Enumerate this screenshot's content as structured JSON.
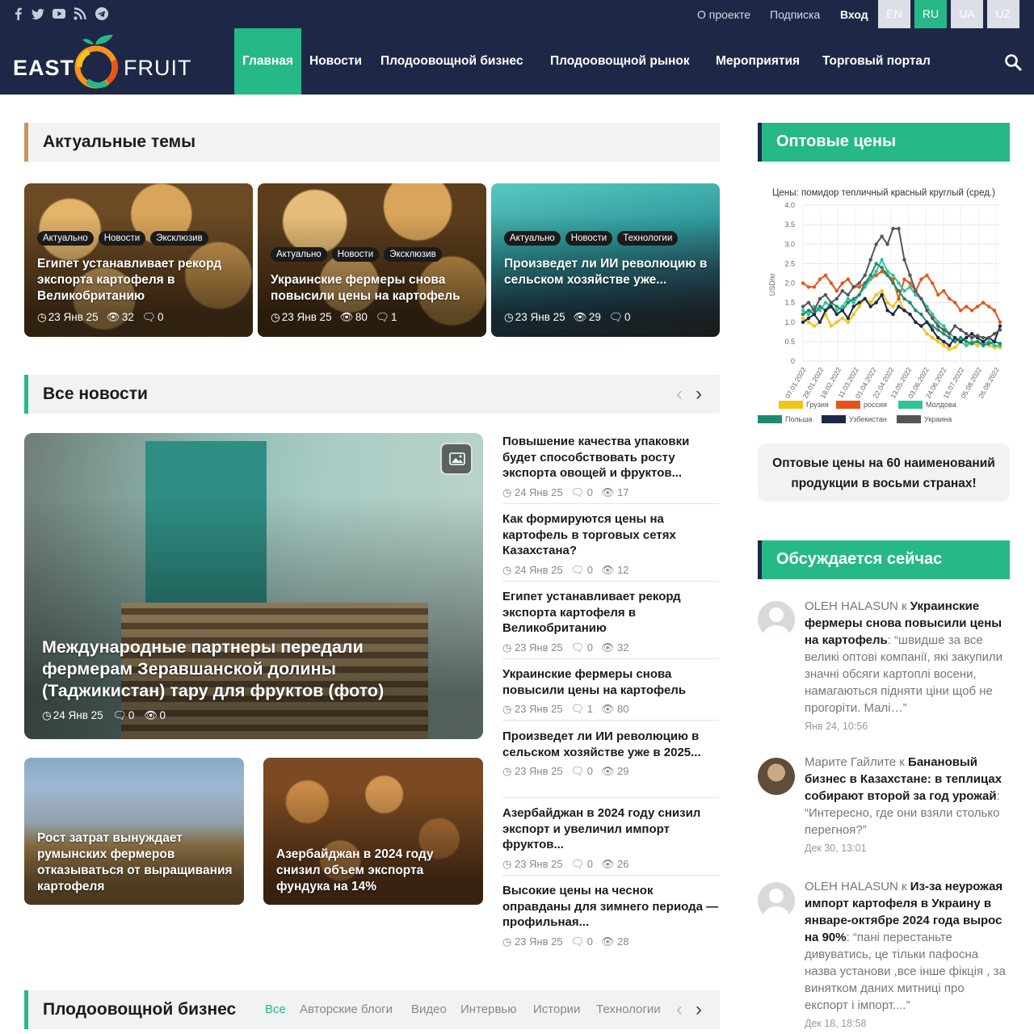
{
  "topbar": {
    "links": [
      "О проекте",
      "Подписка",
      "Вход"
    ],
    "langs": [
      "EN",
      "RU",
      "UA",
      "UZ"
    ],
    "active_lang": "RU",
    "social_icons": [
      "facebook-icon",
      "twitter-icon",
      "youtube-icon",
      "rss-icon",
      "telegram-icon"
    ]
  },
  "logo": {
    "part1": "EAST",
    "part2": "FRUIT"
  },
  "nav": [
    "Главная",
    "Новости",
    "Плодоовощной бизнес",
    "Плодоовощной рынок",
    "Мероприятия",
    "Торговый портал"
  ],
  "trending": {
    "title": "Актуальные темы",
    "cards": [
      {
        "tags": [
          "Актуально",
          "Новости",
          "Эксклюзив"
        ],
        "title": "Египет устанавливает рекорд экспорта картофеля в Великобританию",
        "date": "23 Янв 25",
        "views": "32",
        "comments": "0"
      },
      {
        "tags": [
          "Актуально",
          "Новости",
          "Эксклюзив"
        ],
        "title": "Украинские фермеры снова повысили цены на картофель",
        "date": "23 Янв 25",
        "views": "80",
        "comments": "1"
      },
      {
        "tags": [
          "Актуально",
          "Новости",
          "Технологии"
        ],
        "title": "Произведет ли ИИ революцию в сельском хозяйстве уже...",
        "date": "23 Янв 25",
        "views": "29",
        "comments": "0"
      }
    ]
  },
  "allnews": {
    "title": "Все новости",
    "main": {
      "title": "Международные партнеры передали фермерам Зеравшанской долины (Таджикистан) тару для фруктов (фото)",
      "date": "24 Янв 25",
      "comments": "0",
      "views": "0"
    },
    "small": [
      {
        "title": "Рост затрат вынуждает румынских фермеров отказываться от выращивания картофеля"
      },
      {
        "title": "Азербайджан в 2024 году снизил объем экспорта фундука на 14%"
      }
    ],
    "list": [
      {
        "title": "Повышение качества упаковки будет способствовать росту экспорта овощей и фруктов...",
        "date": "24 Янв 25",
        "comments": "0",
        "views": "17"
      },
      {
        "title": "Как формируются цены на картофель в торговых сетях Казахстана?",
        "date": "24 Янв 25",
        "comments": "0",
        "views": "12"
      },
      {
        "title": "Египет устанавливает рекорд экспорта картофеля в Великобританию",
        "date": "23 Янв 25",
        "comments": "0",
        "views": "32"
      },
      {
        "title": "Украинские фермеры снова повысили цены на картофель",
        "date": "23 Янв 25",
        "comments": "1",
        "views": "80"
      },
      {
        "title": "Произведет ли ИИ революцию в сельском хозяйстве уже в 2025...",
        "date": "23 Янв 25",
        "comments": "0",
        "views": "29"
      },
      {
        "title": "Азербайджан в 2024 году снизил экспорт и увеличил импорт фруктов...",
        "date": "23 Янв 25",
        "comments": "0",
        "views": "26"
      },
      {
        "title": "Высокие цены на чеснок оправданы для зимнего периода — профильная...",
        "date": "23 Янв 25",
        "comments": "0",
        "views": "28"
      }
    ]
  },
  "business": {
    "title": "Плодоовощной бизнес",
    "subnav": [
      "Все",
      "Авторские блоги",
      "Видео",
      "Интервью",
      "Истории",
      "Технологии"
    ],
    "active": "Все"
  },
  "sidebar": {
    "prices_title": "Оптовые цены",
    "prices_button": "Оптовые цены на 60 наименований продукции в восьми странах!",
    "discuss_title": "Обсуждается сейчас",
    "comments": [
      {
        "author": "OLEH HALASUN",
        "to": "к",
        "post": "Украинские фермеры снова повысили цены на картофель",
        "text": ": “швидше за все великі оптові компанії, які закупили значні обсяги картоплі восени, намагаються підняти ціни щоб не прогоріти. Малі…”",
        "date": "Янв 24, 10:56"
      },
      {
        "author": "Марите Гайлите",
        "to": "к",
        "post": "Банановый бизнес в Казахстане: в теплицах собирают второй за год урожай",
        "text": ": “Интересно, где они взяли столько перегноя?”",
        "date": "Дек 30, 13:01"
      },
      {
        "author": "OLEH HALASUN",
        "to": "к",
        "post": "Из-за неурожая импорт картофеля в Украину в январе-октябре 2024 года вырос на 90%",
        "text": ": “пані перестаньте дивуватись, це тільки пафосна назва установи ,все інше фікція , за винятком даних митниці про експорт і імпорт....”",
        "date": "Дек 18, 18:58"
      }
    ]
  },
  "chart_data": {
    "type": "line",
    "title": "Цены: помидор тепличный красный круглый (сред.)",
    "ylabel": "USD/кг",
    "ylim": [
      0,
      4
    ],
    "yticks": [
      "0",
      "0.5",
      "1.0",
      "1.5",
      "2.0",
      "2.5",
      "3.0",
      "3.5",
      "4.0"
    ],
    "xticks": [
      "07.01.2022",
      "28.01.2022",
      "18.02.2022",
      "11.03.2022",
      "01.04.2022",
      "22.04.2022",
      "13.05.2022",
      "03.06.2022",
      "24.06.2022",
      "15.07.2022",
      "05.08.2022",
      "26.08.2022"
    ],
    "series": [
      {
        "name": "Грузия",
        "color": "#f2c417",
        "values": [
          1.1,
          1.0,
          0.9,
          1.0,
          1.2,
          0.9,
          1.0,
          1.1,
          1.0,
          1.2,
          1.4,
          1.6,
          1.5,
          1.7,
          1.8,
          1.5,
          1.4,
          1.6,
          1.3,
          1.2,
          1.0,
          0.9,
          0.7,
          0.6,
          0.5,
          0.4,
          0.3,
          0.35,
          0.5,
          0.4,
          0.45,
          0.4,
          0.5,
          0.4,
          0.35,
          0.35
        ]
      },
      {
        "name": "россия",
        "color": "#e8531a",
        "values": [
          2.0,
          1.9,
          1.9,
          2.1,
          2.2,
          2.0,
          1.8,
          2.0,
          2.1,
          1.9,
          1.9,
          2.0,
          2.1,
          2.2,
          2.3,
          2.2,
          2.1,
          1.6,
          2.1,
          2.0,
          1.8,
          2.1,
          2.2,
          2.0,
          1.7,
          1.8,
          1.6,
          1.5,
          1.3,
          1.4,
          1.3,
          1.4,
          1.5,
          1.4,
          1.3,
          1.0
        ]
      },
      {
        "name": "Молдова",
        "color": "#2ec49a",
        "values": [
          1.3,
          1.2,
          1.4,
          1.3,
          1.5,
          1.4,
          1.3,
          1.4,
          1.6,
          1.5,
          1.7,
          1.9,
          2.1,
          2.3,
          2.6,
          2.3,
          2.2,
          2.0,
          1.8,
          1.9,
          1.7,
          1.6,
          1.4,
          1.2,
          1.0,
          0.9,
          0.7,
          0.6,
          0.5,
          0.4,
          0.5,
          0.5,
          0.45,
          0.5,
          0.4,
          0.4
        ]
      },
      {
        "name": "Польша",
        "color": "#1f8a6f",
        "values": [
          1.2,
          1.3,
          1.2,
          1.4,
          1.3,
          1.5,
          1.4,
          1.3,
          1.5,
          1.6,
          1.7,
          2.0,
          2.2,
          2.5,
          2.4,
          2.2,
          2.0,
          1.8,
          1.6,
          1.5,
          1.3,
          1.2,
          1.0,
          0.9,
          0.8,
          0.7,
          0.6,
          0.5,
          0.6,
          0.5,
          0.45,
          0.5,
          0.4,
          0.45,
          0.5,
          0.45
        ]
      },
      {
        "name": "Узбекистан",
        "color": "#1e2846",
        "values": [
          1.0,
          1.1,
          1.2,
          1.0,
          1.3,
          1.4,
          1.2,
          1.3,
          1.1,
          1.4,
          1.5,
          1.6,
          1.4,
          1.5,
          1.7,
          1.3,
          1.2,
          1.4,
          1.3,
          1.2,
          1.0,
          0.9,
          1.0,
          0.8,
          0.6,
          0.5,
          0.4,
          0.6,
          0.5,
          0.6,
          0.7,
          0.6,
          0.5,
          0.6,
          0.5,
          0.9
        ]
      },
      {
        "name": "Украина",
        "color": "#555555",
        "values": [
          1.4,
          1.5,
          1.3,
          1.6,
          1.7,
          1.5,
          1.6,
          1.8,
          1.7,
          1.9,
          2.0,
          2.2,
          2.6,
          3.0,
          3.2,
          3.0,
          3.4,
          3.4,
          2.6,
          2.2,
          1.8,
          1.6,
          1.3,
          1.1,
          0.9,
          0.8,
          0.7,
          0.9,
          0.8,
          0.7,
          0.6,
          0.65,
          0.6,
          0.6,
          0.7,
          0.8
        ]
      }
    ]
  }
}
